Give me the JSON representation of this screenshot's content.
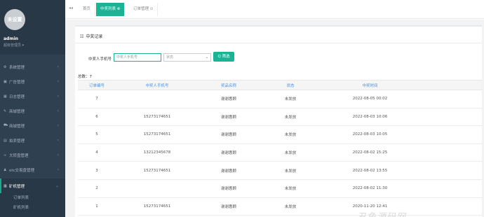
{
  "sidebar": {
    "avatar_text": "未设置",
    "username": "admin",
    "role": "超级管理员 ▾",
    "items": [
      {
        "icon": "gear-icon",
        "glyph": "⚙",
        "label": "系统管理"
      },
      {
        "icon": "image-icon",
        "glyph": "▣",
        "label": "广告管理"
      },
      {
        "icon": "calendar-icon",
        "glyph": "▦",
        "label": "日志管理"
      },
      {
        "icon": "edit-icon",
        "glyph": "✎",
        "label": "商城管理"
      },
      {
        "icon": "cart-icon",
        "glyph": "⛟",
        "label": "商城管理"
      },
      {
        "icon": "list-icon",
        "glyph": "▤",
        "label": "拍卖管理"
      },
      {
        "icon": "link-icon",
        "glyph": "∞",
        "label": "大转盘管理"
      },
      {
        "icon": "user-icon",
        "glyph": "♟",
        "label": "otc交易盘管理"
      },
      {
        "icon": "server-icon",
        "glyph": "▥",
        "label": "矿机管理"
      }
    ],
    "subitems": [
      "订单列表",
      "矿机列表"
    ]
  },
  "topbar": {
    "back_glyph": "◂◂",
    "tabs": [
      {
        "label": "首页"
      },
      {
        "label": "中奖列表 ⊗"
      },
      {
        "label": "订单管理 ⊙"
      }
    ]
  },
  "panel": {
    "title_icon": "☷",
    "title": "中奖记录",
    "filter_label": "中奖人手机号",
    "phone_placeholder": "中奖人手机号",
    "status_select": "状态",
    "search_label": "Q 筛选",
    "total": "总数：7"
  },
  "table": {
    "headers": [
      "订单编号",
      "中奖人手机号",
      "奖品名称",
      "状态",
      "中奖时间"
    ],
    "rows": [
      [
        "7",
        "",
        "谢谢惠顾",
        "未发放",
        "2022-08-05 00:02"
      ],
      [
        "6",
        "15273174651",
        "谢谢惠顾",
        "未发放",
        "2022-08-03 10:06"
      ],
      [
        "5",
        "15273174651",
        "谢谢惠顾",
        "未发放",
        "2022-08-03 10:05"
      ],
      [
        "4",
        "13212345678",
        "谢谢惠顾",
        "未发放",
        "2022-08-02 15:25"
      ],
      [
        "3",
        "15273174651",
        "谢谢惠顾",
        "未发放",
        "2022-08-02 13:55"
      ],
      [
        "2",
        "",
        "谢谢惠顾",
        "未发放",
        "2022-08-02 11:30"
      ],
      [
        "1",
        "15273174651",
        "谢谢惠顾",
        "未发放",
        "2020-11-20 12:41"
      ]
    ]
  },
  "watermark": "丑鱼源码网"
}
